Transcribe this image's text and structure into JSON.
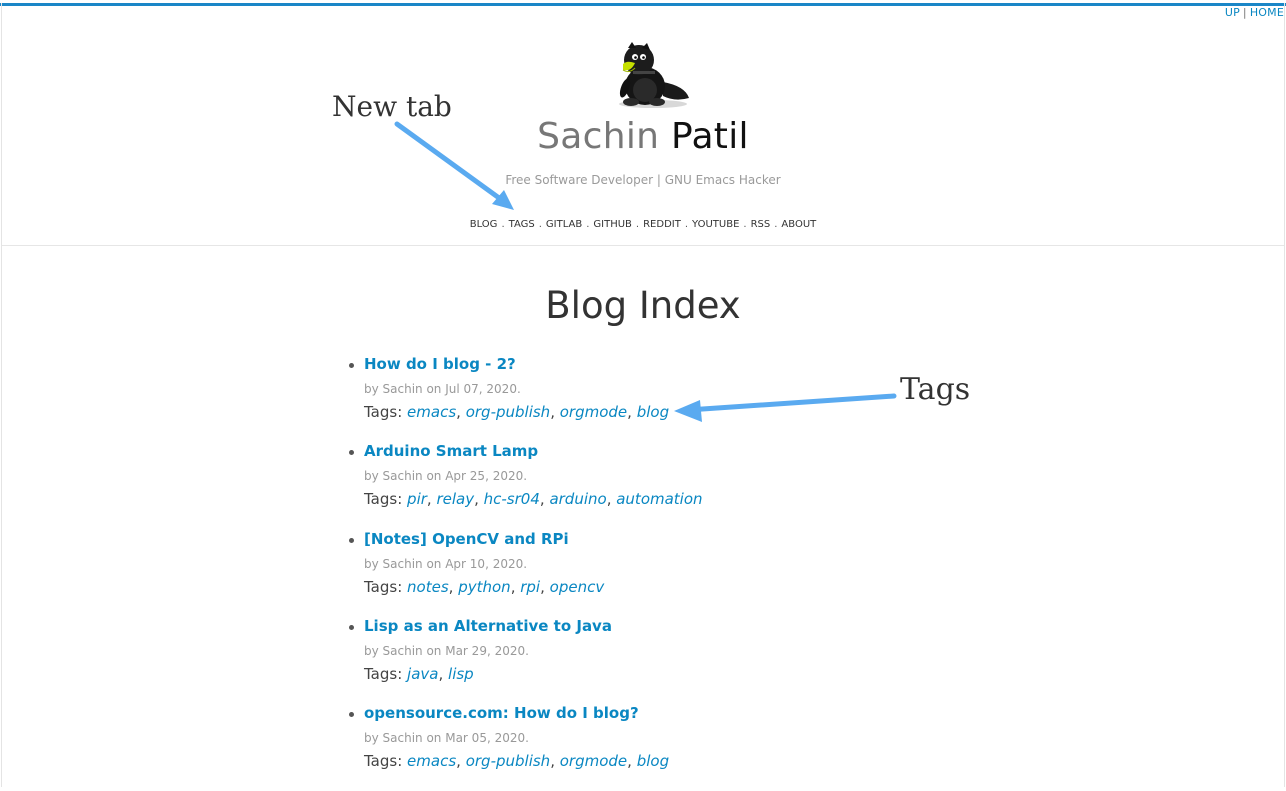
{
  "top_nav": {
    "up": "UP",
    "separator": "|",
    "home": "HOME"
  },
  "site": {
    "first_name": "Sachin",
    "last_name": "Patil",
    "tagline": "Free Software Developer | GNU Emacs Hacker",
    "logo_icon": "penguin-mascot-icon"
  },
  "main_nav": [
    "BLOG",
    "TAGS",
    "GITLAB",
    "GITHUB",
    "REDDIT",
    "YOUTUBE",
    "RSS",
    "ABOUT"
  ],
  "main_nav_separator": ".",
  "page_title": "Blog Index",
  "tags_label": "Tags:",
  "posts": [
    {
      "title": "How do I blog - 2?",
      "meta": "by Sachin on Jul 07, 2020.",
      "tags": [
        "emacs",
        "org-publish",
        "orgmode",
        "blog"
      ]
    },
    {
      "title": "Arduino Smart Lamp",
      "meta": "by Sachin on Apr 25, 2020.",
      "tags": [
        "pir",
        "relay",
        "hc-sr04",
        "arduino",
        "automation"
      ]
    },
    {
      "title": "[Notes] OpenCV and RPi",
      "meta": "by Sachin on Apr 10, 2020.",
      "tags": [
        "notes",
        "python",
        "rpi",
        "opencv"
      ]
    },
    {
      "title": "Lisp as an Alternative to Java",
      "meta": "by Sachin on Mar 29, 2020.",
      "tags": [
        "java",
        "lisp"
      ]
    },
    {
      "title": "opensource.com: How do I blog?",
      "meta": "by Sachin on Mar 05, 2020.",
      "tags": [
        "emacs",
        "org-publish",
        "orgmode",
        "blog"
      ]
    }
  ],
  "annotations": {
    "new_tab": "New tab",
    "tags": "Tags"
  },
  "colors": {
    "accent": "#1a86c7",
    "link": "#0a87c2",
    "arrow": "#5aaaf0"
  }
}
